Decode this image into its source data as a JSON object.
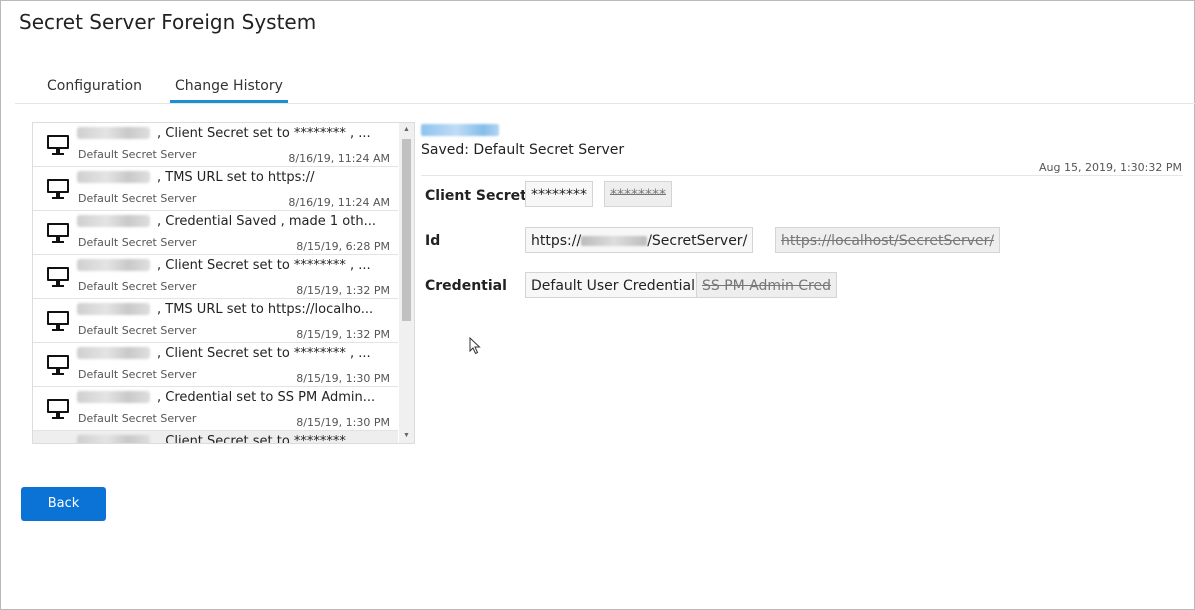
{
  "window": {
    "title": "Secret Server Foreign System"
  },
  "tabs": [
    {
      "label": "Configuration",
      "active": false
    },
    {
      "label": "Change History",
      "active": true
    }
  ],
  "history": [
    {
      "change": ", Client Secret set to ******** , ...",
      "sub": "Default Secret Server",
      "date": "8/16/19, 11:24 AM"
    },
    {
      "change": ", TMS URL set to https://",
      "sub": "Default Secret Server",
      "date": "8/16/19, 11:24 AM"
    },
    {
      "change": ", Credential Saved , made 1 oth...",
      "sub": "Default Secret Server",
      "date": "8/15/19, 6:28 PM"
    },
    {
      "change": ", Client Secret set to ******** , ...",
      "sub": "Default Secret Server",
      "date": "8/15/19, 1:32 PM"
    },
    {
      "change": ", TMS URL set to https://localho...",
      "sub": "Default Secret Server",
      "date": "8/15/19, 1:32 PM"
    },
    {
      "change": ", Client Secret set to ******** , ...",
      "sub": "Default Secret Server",
      "date": "8/15/19, 1:30 PM"
    },
    {
      "change": ", Credential set to SS PM Admin...",
      "sub": "Default Secret Server",
      "date": "8/15/19, 1:30 PM"
    },
    {
      "change": ", Client Secret set to ******** , ...",
      "sub": "",
      "date": ""
    }
  ],
  "detail": {
    "saved": "Saved: Default Secret Server",
    "timestamp": "Aug 15, 2019, 1:30:32 PM",
    "fields": [
      {
        "label": "Client Secret",
        "new": "********",
        "old": "********"
      },
      {
        "label": "Id",
        "new_prefix": "https://",
        "new_suffix": "/SecretServer/",
        "old": "https://localhost/SecretServer/"
      },
      {
        "label": "Credential",
        "new": "Default User Credential",
        "old": "SS PM Admin Cred"
      }
    ]
  },
  "buttons": {
    "back": "Back"
  },
  "colors": {
    "accent": "#0b73d6",
    "tab_underline": "#1a8fd1"
  }
}
